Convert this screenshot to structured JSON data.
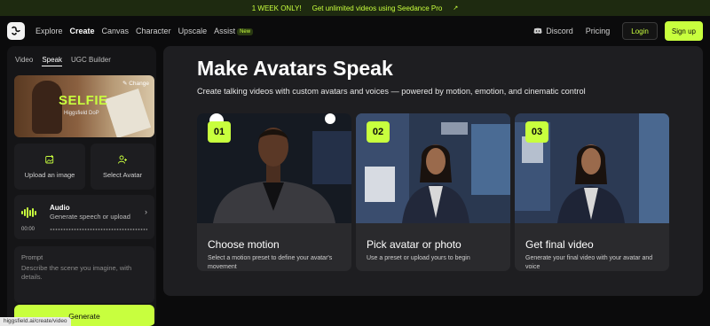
{
  "promo": {
    "badge": "1 WEEK ONLY!",
    "text": "Get unlimited videos using Seedance Pro",
    "arrow": "↗"
  },
  "nav": {
    "items": [
      "Explore",
      "Create",
      "Canvas",
      "Character",
      "Upscale",
      "Assist"
    ],
    "new_badge": "New",
    "discord": "Discord",
    "pricing": "Pricing",
    "login": "Login",
    "signup": "Sign up"
  },
  "sidebar": {
    "tabs": [
      "Video",
      "Speak",
      "UGC Builder"
    ],
    "preset": {
      "title": "SELFIE",
      "subtitle": "Higgsfield DoP",
      "change": "Change"
    },
    "upload_label": "Upload an image",
    "select_avatar_label": "Select Avatar",
    "audio": {
      "title": "Audio",
      "subtitle": "Generate speech or upload",
      "time": "00:00"
    },
    "prompt": {
      "label": "Prompt",
      "placeholder": "Describe the scene you imagine, with details."
    },
    "generate": "Generate"
  },
  "status_url": "higgsfield.ai/create/video",
  "main": {
    "title": "Make Avatars Speak",
    "subtitle": "Create talking videos with custom avatars and voices — powered by motion, emotion, and cinematic control",
    "cards": [
      {
        "num": "01",
        "title": "Choose motion",
        "desc": "Select a motion preset to define your avatar's movement"
      },
      {
        "num": "02",
        "title": "Pick avatar or photo",
        "desc": "Use a preset or upload yours to begin"
      },
      {
        "num": "03",
        "title": "Get final video",
        "desc": "Generate your final video with your avatar and voice"
      }
    ]
  },
  "colors": {
    "accent": "#c8ff3e",
    "background": "#0b0b0c",
    "panel": "#1e1e21"
  }
}
